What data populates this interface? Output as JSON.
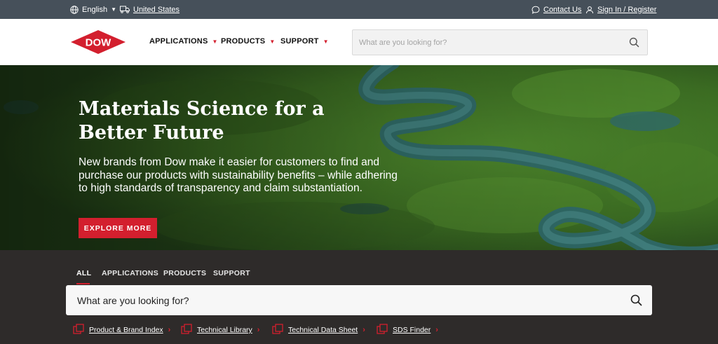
{
  "utility_bar": {
    "language": "English",
    "region": "United States",
    "contact": "Contact Us",
    "signin": "Sign In / Register"
  },
  "brand": {
    "logo_text": "DOW",
    "red": "#d31f2e"
  },
  "nav": {
    "items": [
      {
        "label": "APPLICATIONS"
      },
      {
        "label": "PRODUCTS"
      },
      {
        "label": "SUPPORT"
      }
    ],
    "search_placeholder": "What are you looking for?"
  },
  "hero": {
    "title": "Materials Science for a Better Future",
    "body": "New brands from Dow make it easier for customers to find and purchase our products with sustainability benefits – while adhering to high standards of transparency and claim substantiation.",
    "cta": "EXPLORE MORE"
  },
  "search_panel": {
    "tabs": [
      {
        "label": "ALL",
        "active": true
      },
      {
        "label": "APPLICATIONS"
      },
      {
        "label": "PRODUCTS"
      },
      {
        "label": "SUPPORT"
      }
    ],
    "placeholder": "What are you looking for?",
    "quick_links": [
      {
        "label": "Product & Brand Index"
      },
      {
        "label": "Technical Library"
      },
      {
        "label": "Technical Data Sheet"
      },
      {
        "label": "SDS Finder"
      }
    ]
  }
}
